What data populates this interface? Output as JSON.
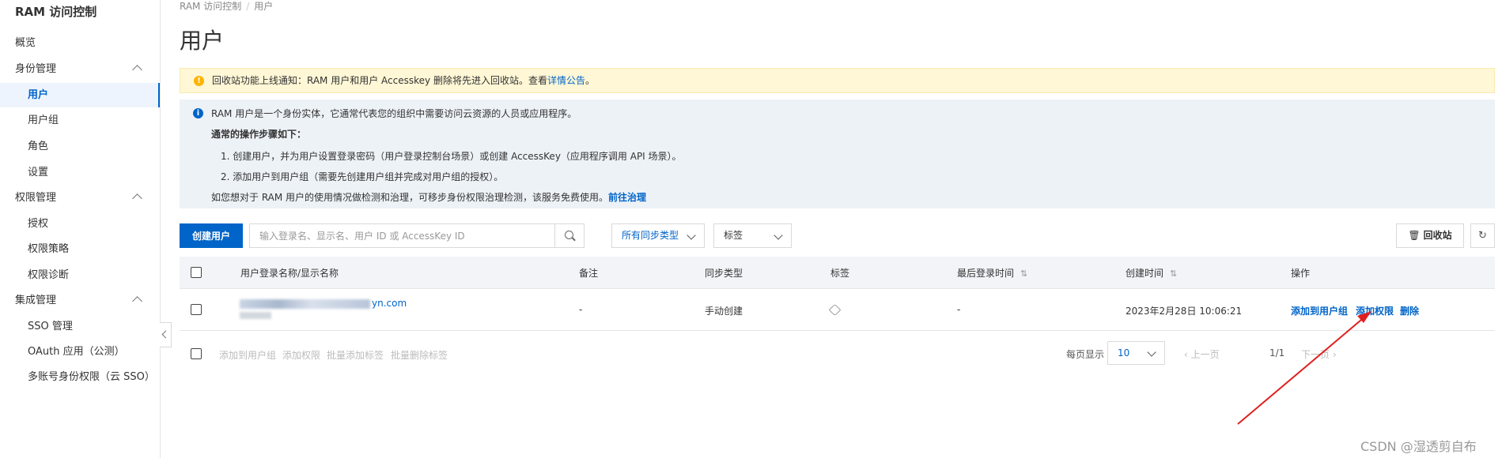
{
  "sidebar": {
    "app_title": "RAM 访问控制",
    "overview": "概览",
    "groups": [
      {
        "label": "身份管理",
        "items": [
          "用户",
          "用户组",
          "角色",
          "设置"
        ]
      },
      {
        "label": "权限管理",
        "items": [
          "授权",
          "权限策略",
          "权限诊断"
        ]
      },
      {
        "label": "集成管理",
        "items": [
          "SSO 管理",
          "OAuth 应用（公测）",
          "多账号身份权限（云 SSO）"
        ]
      }
    ],
    "active_item": "用户"
  },
  "breadcrumb": [
    "RAM 访问控制",
    "用户"
  ],
  "page_title": "用户",
  "notice": {
    "text": "回收站功能上线通知：RAM 用户和用户 Accesskey 删除将先进入回收站。查看",
    "link": "详情公告",
    "suffix": "。"
  },
  "info": {
    "line1": "RAM 用户是一个身份实体，它通常代表您的组织中需要访问云资源的人员或应用程序。",
    "heading": "通常的操作步骤如下：",
    "step1": "1. 创建用户，并为用户设置登录密码（用户登录控制台场景）或创建 AccessKey（应用程序调用 API 场景）。",
    "step2": "2. 添加用户到用户组（需要先创建用户组并完成对用户组的授权）。",
    "line_last": "如您想对于 RAM 用户的使用情况做检测和治理，可移步身份权限治理检测，该服务免费使用。",
    "link": "前往治理"
  },
  "toolbar": {
    "create_user": "创建用户",
    "search_placeholder": "输入登录名、显示名、用户 ID 或 AccessKey ID",
    "sync_select": "所有同步类型",
    "tag_select": "标签",
    "recycle": "回收站"
  },
  "table": {
    "headers": [
      "用户登录名称/显示名称",
      "备注",
      "同步类型",
      "标签",
      "最后登录时间",
      "创建时间",
      "操作"
    ],
    "rows": [
      {
        "login_suffix": "yn.com",
        "remark": "-",
        "sync_type": "手动创建",
        "last_login": "-",
        "created": "2023年2月28日 10:06:21",
        "actions": [
          "添加到用户组",
          "添加权限",
          "删除"
        ]
      }
    ]
  },
  "bulk_actions": [
    "添加到用户组",
    "添加权限",
    "批量添加标签",
    "批量删除标签"
  ],
  "pagination": {
    "per_page_label": "每页显示",
    "per_page": "10",
    "prev": "上一页",
    "page": "1/1",
    "next": "下一页"
  },
  "watermark": "CSDN @湿透剪自布",
  "colors": {
    "primary": "#0064c8",
    "notice_bg": "#fff7d6",
    "info_bg": "#edf2f7",
    "annotation": "#e02020"
  }
}
